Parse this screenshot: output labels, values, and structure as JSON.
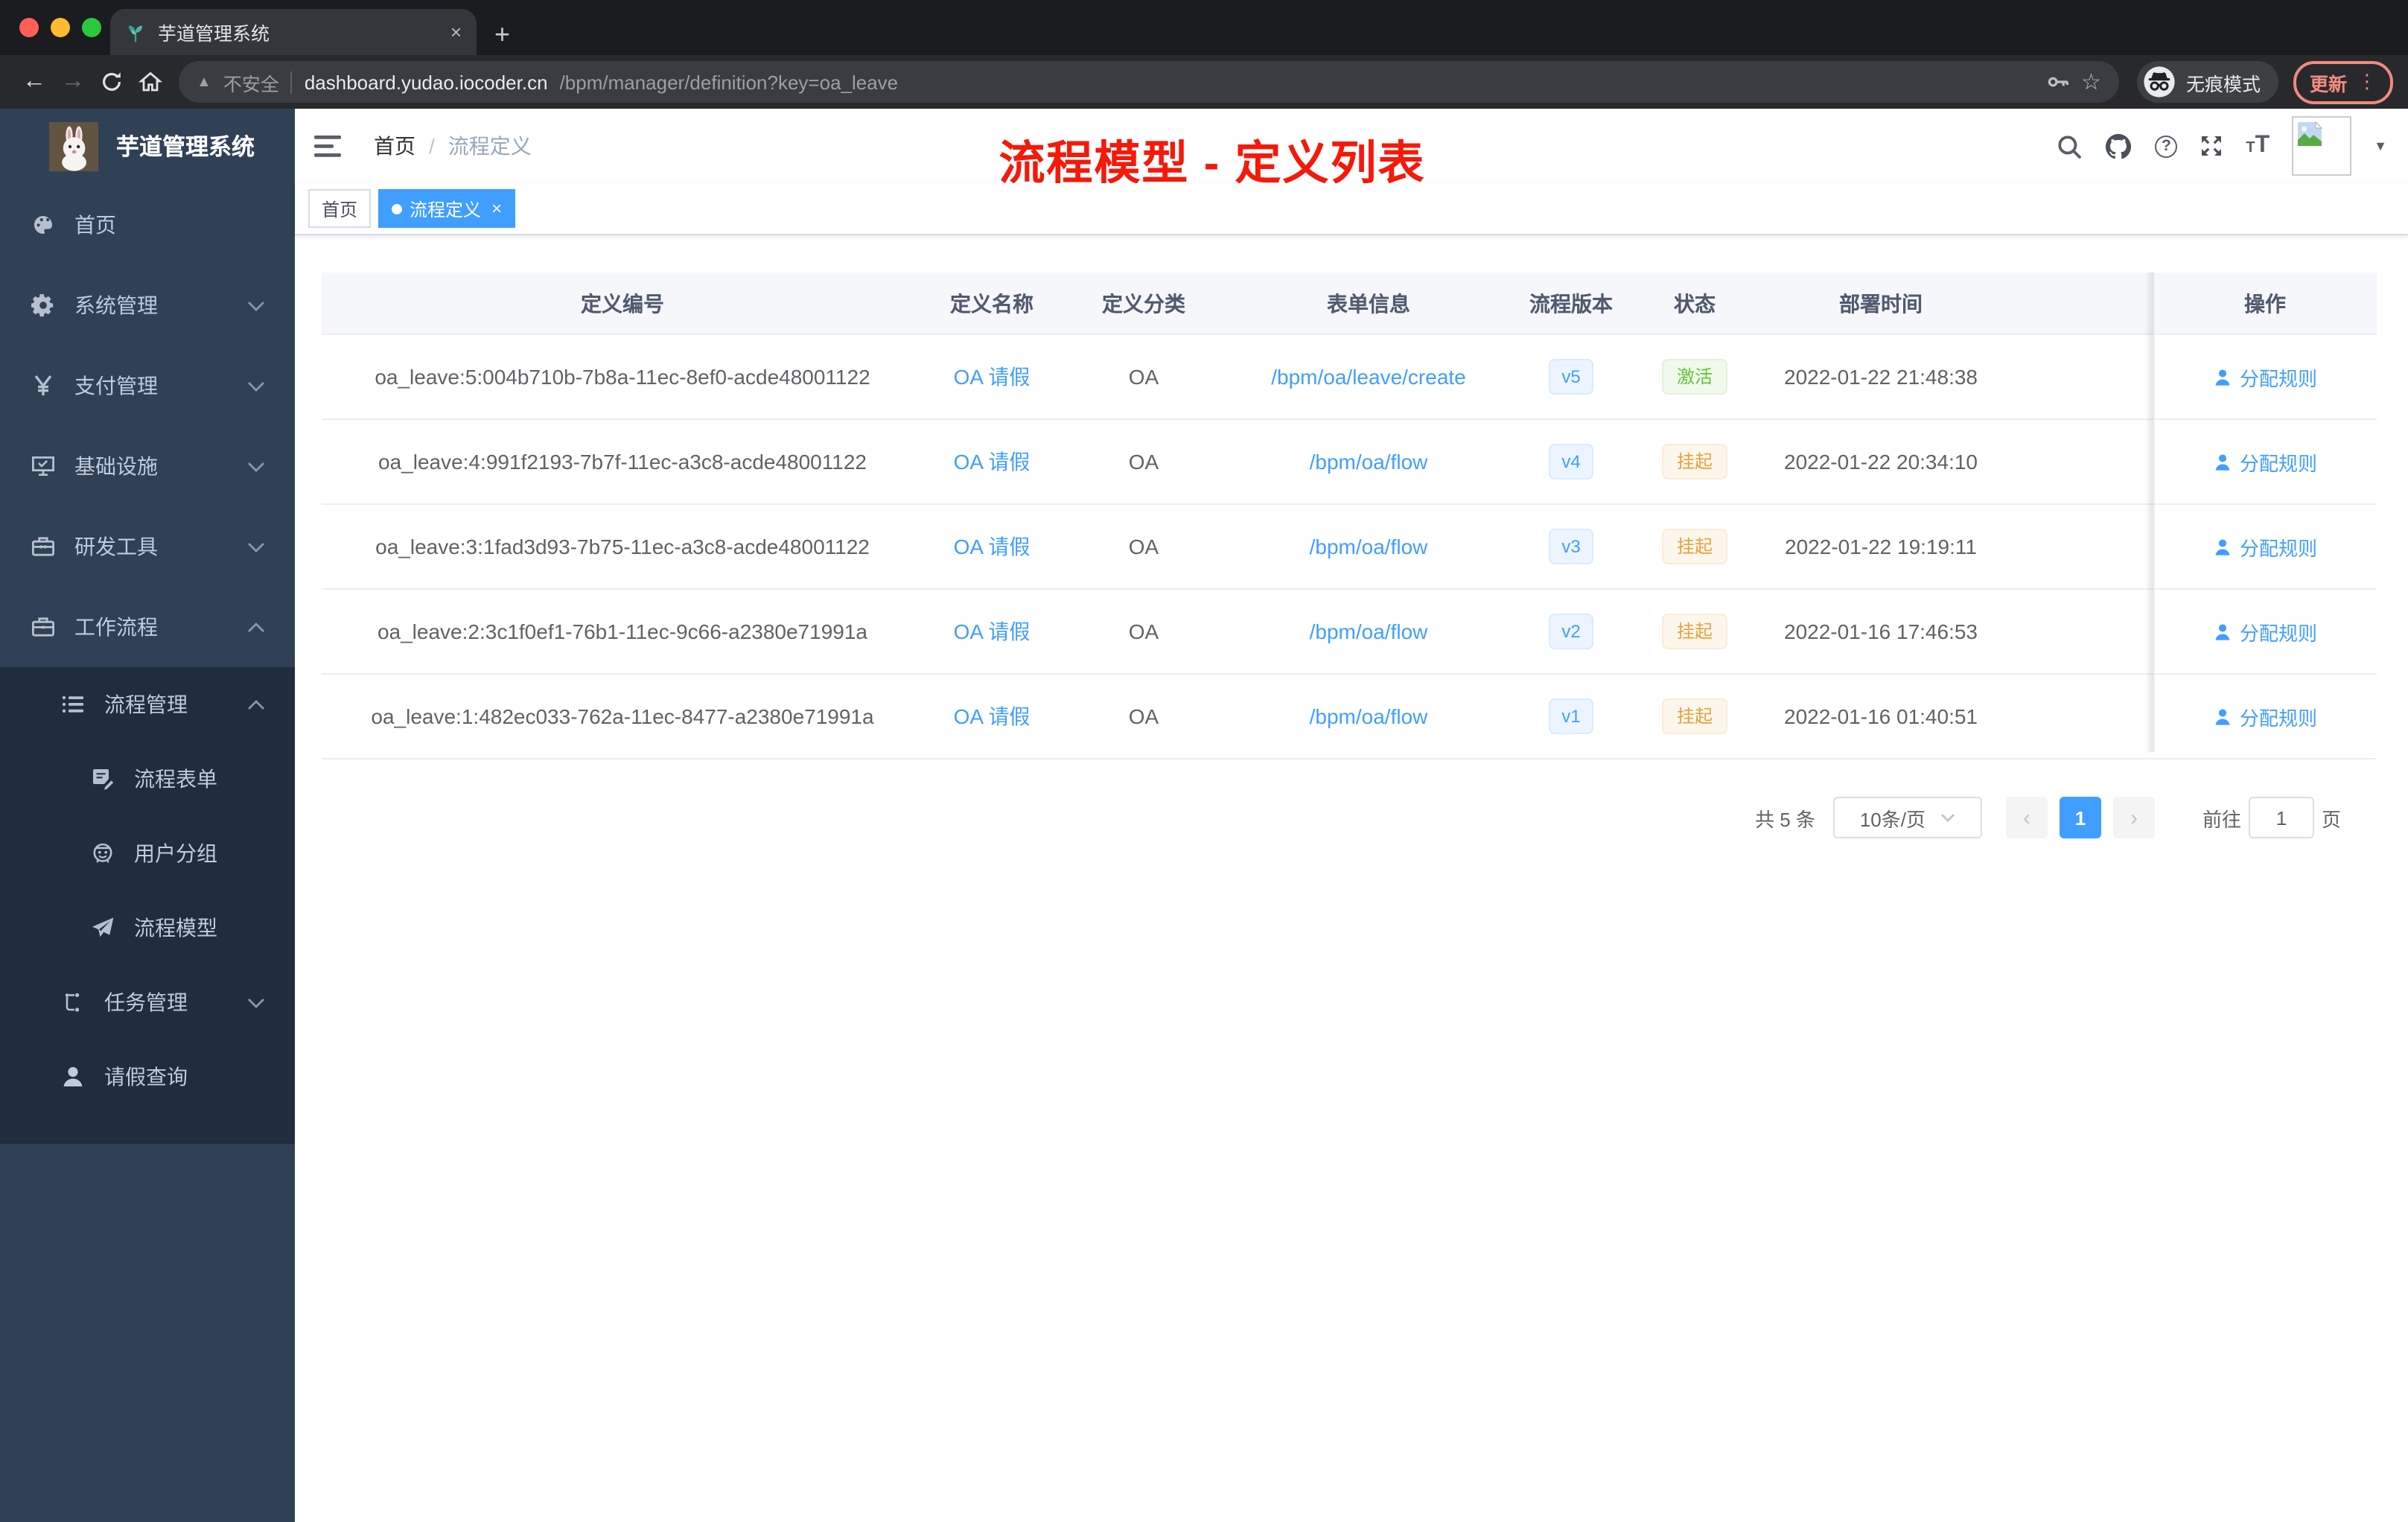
{
  "browser": {
    "traffic_lights": [
      "close",
      "minimize",
      "zoom"
    ],
    "tab": {
      "title": "芋道管理系统",
      "favicon": "plant-icon",
      "close_glyph": "×",
      "new_tab_glyph": "+"
    },
    "toolbar": {
      "back_glyph": "←",
      "forward_glyph": "→",
      "security_label": "不安全",
      "url_host": "dashboard.yudao.iocoder.cn",
      "url_path": "/bpm/manager/definition?key=oa_leave",
      "incognito_label": "无痕模式",
      "update_label": "更新",
      "menu_dots_glyph": "⋮",
      "star_glyph": "☆",
      "warn_glyph": "▲"
    }
  },
  "sidebar": {
    "logo_title": "芋道管理系统",
    "menu": [
      {
        "label": "首页",
        "icon": "dashboard-icon",
        "level": 1,
        "chevron": "",
        "dark": false
      },
      {
        "label": "系统管理",
        "icon": "gear-icon",
        "level": 1,
        "chevron": "down",
        "dark": false
      },
      {
        "label": "支付管理",
        "icon": "yen-icon",
        "level": 1,
        "chevron": "down",
        "dark": false
      },
      {
        "label": "基础设施",
        "icon": "monitor-icon",
        "level": 1,
        "chevron": "down",
        "dark": false
      },
      {
        "label": "研发工具",
        "icon": "toolbox-icon",
        "level": 1,
        "chevron": "down",
        "dark": false
      },
      {
        "label": "工作流程",
        "icon": "briefcase-icon",
        "level": 1,
        "chevron": "up",
        "dark": false
      },
      {
        "label": "流程管理",
        "icon": "flow-list-icon",
        "level": 2,
        "chevron": "up",
        "dark": true
      },
      {
        "label": "流程表单",
        "icon": "form-doc-icon",
        "level": 3,
        "chevron": "",
        "dark": true
      },
      {
        "label": "用户分组",
        "icon": "user-group-icon",
        "level": 3,
        "chevron": "",
        "dark": true
      },
      {
        "label": "流程模型",
        "icon": "paper-plane-icon",
        "level": 3,
        "chevron": "",
        "dark": true
      },
      {
        "label": "任务管理",
        "icon": "task-tree-icon",
        "level": 2,
        "chevron": "down",
        "dark": true
      },
      {
        "label": "请假查询",
        "icon": "user-icon",
        "level": 2,
        "chevron": "",
        "dark": true
      }
    ]
  },
  "navbar": {
    "breadcrumb": {
      "home": "首页",
      "separator": "/",
      "current": "流程定义"
    },
    "annotation": {
      "text": "流程模型 - 定义列表",
      "color": "#f5190a"
    },
    "icons": [
      "search-icon",
      "github-icon",
      "question-icon",
      "fullscreen-icon",
      "font-size-icon",
      "avatar",
      "caret-down-icon"
    ],
    "font_size_small": "T",
    "font_size_big": "T",
    "caret_glyph": "▼"
  },
  "tags_bar": {
    "tags": [
      {
        "label": "首页",
        "active": false,
        "closable": false
      },
      {
        "label": "流程定义",
        "active": true,
        "closable": true,
        "close_glyph": "×"
      }
    ]
  },
  "table": {
    "columns": [
      "定义编号",
      "定义名称",
      "定义分类",
      "表单信息",
      "流程版本",
      "状态",
      "部署时间",
      "操作"
    ],
    "action_label": "分配规则",
    "rows": [
      {
        "id": "oa_leave:5:004b710b-7b8a-11ec-8ef0-acde48001122",
        "name": "OA 请假",
        "category": "OA",
        "form": "/bpm/oa/leave/create",
        "version": "v5",
        "status": "激活",
        "status_type": "active",
        "time": "2022-01-22 21:48:38",
        "action": "分配规则"
      },
      {
        "id": "oa_leave:4:991f2193-7b7f-11ec-a3c8-acde48001122",
        "name": "OA 请假",
        "category": "OA",
        "form": "/bpm/oa/flow",
        "version": "v4",
        "status": "挂起",
        "status_type": "suspend",
        "time": "2022-01-22 20:34:10",
        "action": "分配规则"
      },
      {
        "id": "oa_leave:3:1fad3d93-7b75-11ec-a3c8-acde48001122",
        "name": "OA 请假",
        "category": "OA",
        "form": "/bpm/oa/flow",
        "version": "v3",
        "status": "挂起",
        "status_type": "suspend",
        "time": "2022-01-22 19:19:11",
        "action": "分配规则"
      },
      {
        "id": "oa_leave:2:3c1f0ef1-76b1-11ec-9c66-a2380e71991a",
        "name": "OA 请假",
        "category": "OA",
        "form": "/bpm/oa/flow",
        "version": "v2",
        "status": "挂起",
        "status_type": "suspend",
        "time": "2022-01-16 17:46:53",
        "action": "分配规则"
      },
      {
        "id": "oa_leave:1:482ec033-762a-11ec-8477-a2380e71991a",
        "name": "OA 请假",
        "category": "OA",
        "form": "/bpm/oa/flow",
        "version": "v1",
        "status": "挂起",
        "status_type": "suspend",
        "time": "2022-01-16 01:40:51",
        "action": "分配规则"
      }
    ]
  },
  "pagination": {
    "total": "共 5 条",
    "page_size": "10条/页",
    "prev_glyph": "‹",
    "current_page": "1",
    "next_glyph": "›",
    "goto_label": "前往",
    "goto_value": "1",
    "unit_label": "页"
  },
  "colors": {
    "accent": "#409eff",
    "annotation_red": "#f5190a",
    "sidebar_bg": "#304156",
    "submenu_bg": "#1f2d3d",
    "version_tag": {
      "text": "#409eff",
      "bg": "#ecf5ff",
      "border": "#d9ecff"
    },
    "status_active": {
      "text": "#67c23a",
      "bg": "#f0f9eb",
      "border": "#e1f3d8"
    },
    "status_suspend": {
      "text": "#e6a23c",
      "bg": "#fdf6ec",
      "border": "#faecd8"
    }
  }
}
